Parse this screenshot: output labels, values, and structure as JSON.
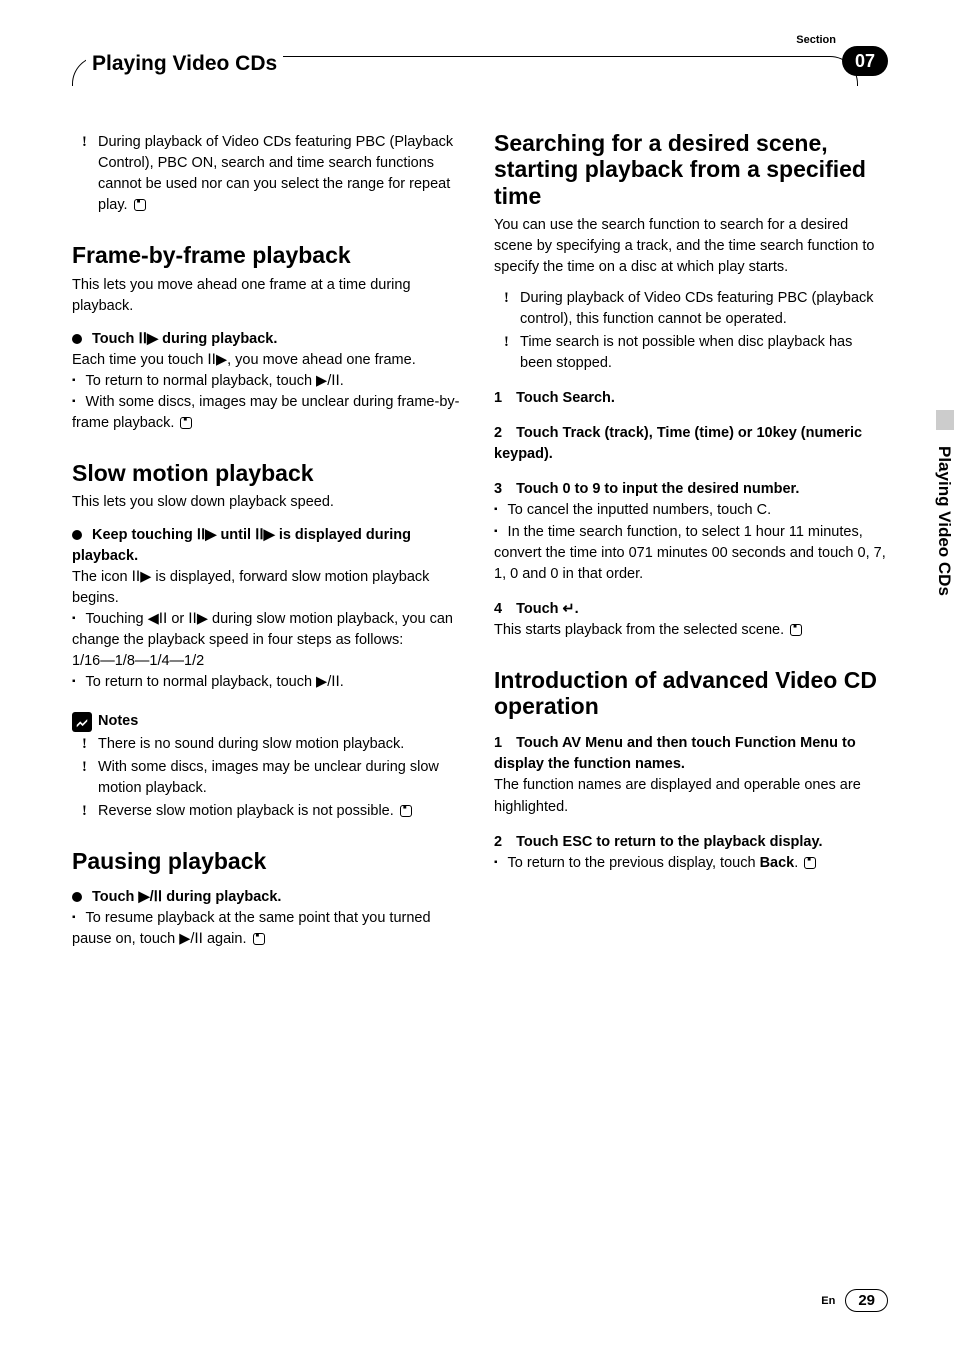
{
  "header": {
    "section_label": "Section",
    "chapter_number": "07",
    "chapter_title": "Playing Video CDs",
    "side_tab": "Playing Video CDs"
  },
  "left": {
    "top_bullet": "During playback of Video CDs featuring PBC (Playback Control), PBC ON, search and time search functions cannot be used nor can you select the range for repeat play.",
    "h_frame": "Frame-by-frame playback",
    "frame_intro": "This lets you move ahead one frame at a time during playback.",
    "frame_step_head": "Touch ⅠⅠ▶ during playback.",
    "frame_step_body": "Each time you touch ⅠⅠ▶, you move ahead one frame.",
    "frame_b1": "To return to normal playback, touch ▶/ⅠⅠ.",
    "frame_b2": "With some discs, images may be unclear during frame-by-frame playback.",
    "h_slow": "Slow motion playback",
    "slow_intro": "This lets you slow down playback speed.",
    "slow_step_head": "Keep touching ⅠⅠ▶ until ⅠⅠ▶ is displayed during playback.",
    "slow_step_body": "The icon ⅠⅠ▶ is displayed, forward slow motion playback begins.",
    "slow_b1": "Touching ◀ⅠⅠ or ⅠⅠ▶ during slow motion playback, you can change the playback speed in four steps as follows:",
    "slow_speeds": "1/16—1/8—1/4—1/2",
    "slow_b2": "To return to normal playback, touch ▶/ⅠⅠ.",
    "notes_label": "Notes",
    "note1": "There is no sound during slow motion playback.",
    "note2": "With some discs, images may be unclear during slow motion playback.",
    "note3": "Reverse slow motion playback is not possible.",
    "h_pause": "Pausing playback",
    "pause_step_head": "Touch ▶/ⅠⅠ during playback.",
    "pause_b1": "To resume playback at the same point that you turned pause on, touch ▶/ⅠⅠ again."
  },
  "right": {
    "h_search": "Searching for a desired scene, starting playback from a specified time",
    "search_intro": "You can use the search function to search for a desired scene by specifying a track, and the time search function to specify the time on a disc at which play starts.",
    "search_bul1": "During playback of Video CDs featuring PBC (playback control), this function cannot be operated.",
    "search_bul2": "Time search is not possible when disc playback has been stopped.",
    "s1": "Touch Search.",
    "s2": "Touch Track (track), Time (time) or 10key (numeric keypad).",
    "s3": "Touch 0 to 9 to input the desired number.",
    "s3_b1": "To cancel the inputted numbers, touch C.",
    "s3_b2": "In the time search function, to select 1 hour 11 minutes, convert the time into 071 minutes 00 seconds and touch 0, 7, 1, 0 and 0 in that order.",
    "s4": "Touch ↵.",
    "s4_body": "This starts playback from the selected scene.",
    "h_adv": "Introduction of advanced Video CD operation",
    "a1": "Touch AV Menu and then touch Function Menu to display the function names.",
    "a1_body": "The function names are displayed and operable ones are highlighted.",
    "a2": "Touch ESC to return to the playback display.",
    "a2_b1_pre": "To return to the previous display, touch ",
    "a2_b1_bold": "Back"
  },
  "footer": {
    "lang": "En",
    "page": "29"
  }
}
